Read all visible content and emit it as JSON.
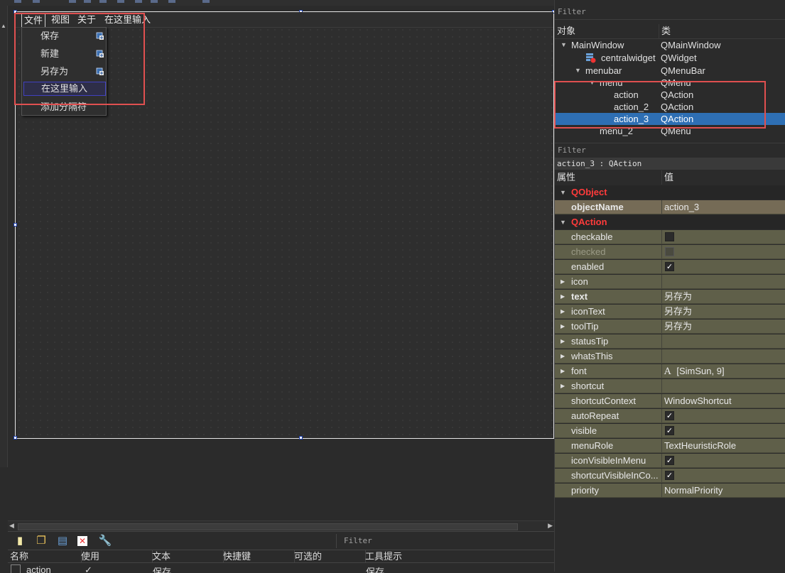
{
  "designer": {
    "menubar": {
      "items": [
        "文件",
        "视图",
        "关于",
        "在这里输入"
      ]
    },
    "file_menu": {
      "items": [
        "保存",
        "新建",
        "另存为"
      ],
      "type_here": "在这里输入",
      "add_separator": "添加分隔符"
    }
  },
  "action_editor": {
    "filter_placeholder": "Filter",
    "columns": [
      "名称",
      "使用",
      "文本",
      "快捷键",
      "可选的",
      "工具提示"
    ],
    "row": {
      "name": "action",
      "used": "✓",
      "text": "保存",
      "tooltip": "保存"
    }
  },
  "object_inspector": {
    "filter_placeholder": "Filter",
    "header": {
      "object": "对象",
      "class": "类"
    },
    "rows": [
      {
        "name": "MainWindow",
        "class": "QMainWindow"
      },
      {
        "name": "centralwidget",
        "class": "QWidget"
      },
      {
        "name": "menubar",
        "class": "QMenuBar"
      },
      {
        "name": "menu",
        "class": "QMenu"
      },
      {
        "name": "action",
        "class": "QAction"
      },
      {
        "name": "action_2",
        "class": "QAction"
      },
      {
        "name": "action_3",
        "class": "QAction"
      },
      {
        "name": "menu_2",
        "class": "QMenu"
      }
    ]
  },
  "property_editor": {
    "filter_placeholder": "Filter",
    "title": "action_3 : QAction",
    "header": {
      "property": "属性",
      "value": "值"
    },
    "sections": {
      "qobject": "QObject",
      "qaction": "QAction"
    },
    "object_name": {
      "name": "objectName",
      "value": "action_3"
    },
    "props": {
      "checkable": {
        "name": "checkable",
        "checked": false
      },
      "checked": {
        "name": "checked",
        "checked": false,
        "disabled": true
      },
      "enabled": {
        "name": "enabled",
        "checked": true
      },
      "icon": {
        "name": "icon",
        "value": ""
      },
      "text": {
        "name": "text",
        "value": "另存为"
      },
      "iconText": {
        "name": "iconText",
        "value": "另存为"
      },
      "toolTip": {
        "name": "toolTip",
        "value": "另存为"
      },
      "statusTip": {
        "name": "statusTip",
        "value": ""
      },
      "whatsThis": {
        "name": "whatsThis",
        "value": ""
      },
      "font": {
        "name": "font",
        "value": "[SimSun, 9]",
        "glyph": "A"
      },
      "shortcut": {
        "name": "shortcut",
        "value": ""
      },
      "shortcutContext": {
        "name": "shortcutContext",
        "value": "WindowShortcut"
      },
      "autoRepeat": {
        "name": "autoRepeat",
        "checked": true
      },
      "visible": {
        "name": "visible",
        "checked": true
      },
      "menuRole": {
        "name": "menuRole",
        "value": "TextHeuristicRole"
      },
      "iconVisibleInMenu": {
        "name": "iconVisibleInMenu",
        "checked": true
      },
      "shortcutVisibleInContextMenu": {
        "name": "shortcutVisibleInCo...",
        "checked": true
      },
      "priority": {
        "name": "priority",
        "value": "NormalPriority"
      }
    },
    "checkmark": "✓"
  },
  "colors": {
    "highlight_box": "#e05050",
    "selection": "#2e6fb4",
    "section_label": "#ff3b3b",
    "property_row": "#5f5f49"
  }
}
